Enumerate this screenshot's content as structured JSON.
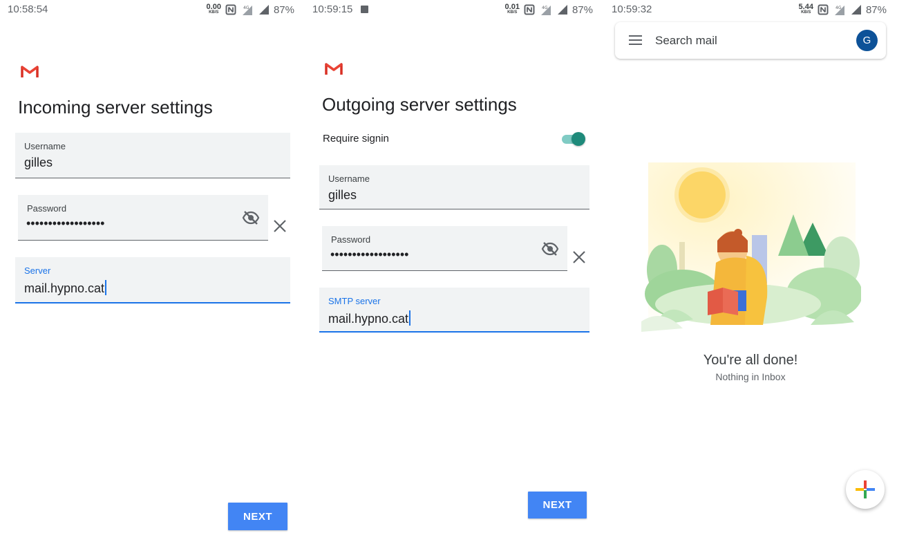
{
  "screens": [
    {
      "status": {
        "time": "10:58:54",
        "speed": "0.00",
        "speed_unit": "KB/S",
        "network": "4G",
        "battery": "87%"
      },
      "title": "Incoming server settings",
      "fields": {
        "username": {
          "label": "Username",
          "value": "gilles"
        },
        "password": {
          "label": "Password",
          "value": "••••••••••••••••••"
        },
        "server": {
          "label": "Server",
          "value": "mail.hypno.cat"
        }
      },
      "next_label": "NEXT"
    },
    {
      "status": {
        "time": "10:59:15",
        "speed": "0.01",
        "speed_unit": "KB/S",
        "network": "4G",
        "battery": "87%"
      },
      "title": "Outgoing server settings",
      "require_signin": {
        "label": "Require signin",
        "enabled": true
      },
      "fields": {
        "username": {
          "label": "Username",
          "value": "gilles"
        },
        "password": {
          "label": "Password",
          "value": "••••••••••••••••••"
        },
        "server": {
          "label": "SMTP server",
          "value": "mail.hypno.cat"
        }
      },
      "next_label": "NEXT"
    },
    {
      "status": {
        "time": "10:59:32",
        "speed": "5.44",
        "speed_unit": "KB/S",
        "network": "4G",
        "battery": "87%"
      },
      "search_placeholder": "Search mail",
      "avatar_letter": "G",
      "done_title": "You're all done!",
      "done_subtitle": "Nothing in Inbox"
    }
  ],
  "colors": {
    "accent": "#1a73e8",
    "button": "#4285f4",
    "toggle": "#1e8a7a",
    "avatar": "#0d5298"
  },
  "icons": [
    "gmail-logo",
    "eye-off-icon",
    "close-icon",
    "menu-icon",
    "compose-plus-icon",
    "image-notification-icon",
    "nfc-icon",
    "signal-icon"
  ]
}
